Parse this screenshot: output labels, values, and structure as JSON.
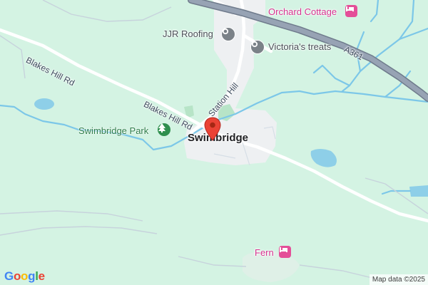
{
  "map": {
    "place_label": "Swimbridge",
    "roads": {
      "blakes_hill_rd_west": "Blakes Hill Rd",
      "blakes_hill_rd_east": "Blakes Hill Rd",
      "station_hill": "Station Hill",
      "a361": "A361"
    },
    "pois": {
      "jjr_roofing": "JJR Roofing",
      "victorias_treats": "Victoria's treats",
      "orchard_cottage": "Orchard Cottage",
      "swimbridge_park": "Swimbridge Park",
      "fern": "Fern"
    },
    "colors": {
      "land": "#d4f3e3",
      "river": "#7cc7e8",
      "road": "#ffffff",
      "major_road": "#8b97a8",
      "settlement": "#eef0f2",
      "pin": "#ea4335",
      "lodging_poi": "#e44e98",
      "park_poi": "#2f8f4e",
      "generic_poi": "#7b8288"
    },
    "icons": {
      "pin": "location-pin-icon",
      "lodging": "bed-icon",
      "park": "tree-icon",
      "business": "generic-poi-icon"
    }
  },
  "footer": {
    "logo_letters": [
      "G",
      "o",
      "o",
      "g",
      "l",
      "e"
    ],
    "logo_colors": [
      "#4285f4",
      "#ea4335",
      "#fbbc05",
      "#4285f4",
      "#34a853",
      "#ea4335"
    ],
    "attribution": "Map data ©2025"
  }
}
